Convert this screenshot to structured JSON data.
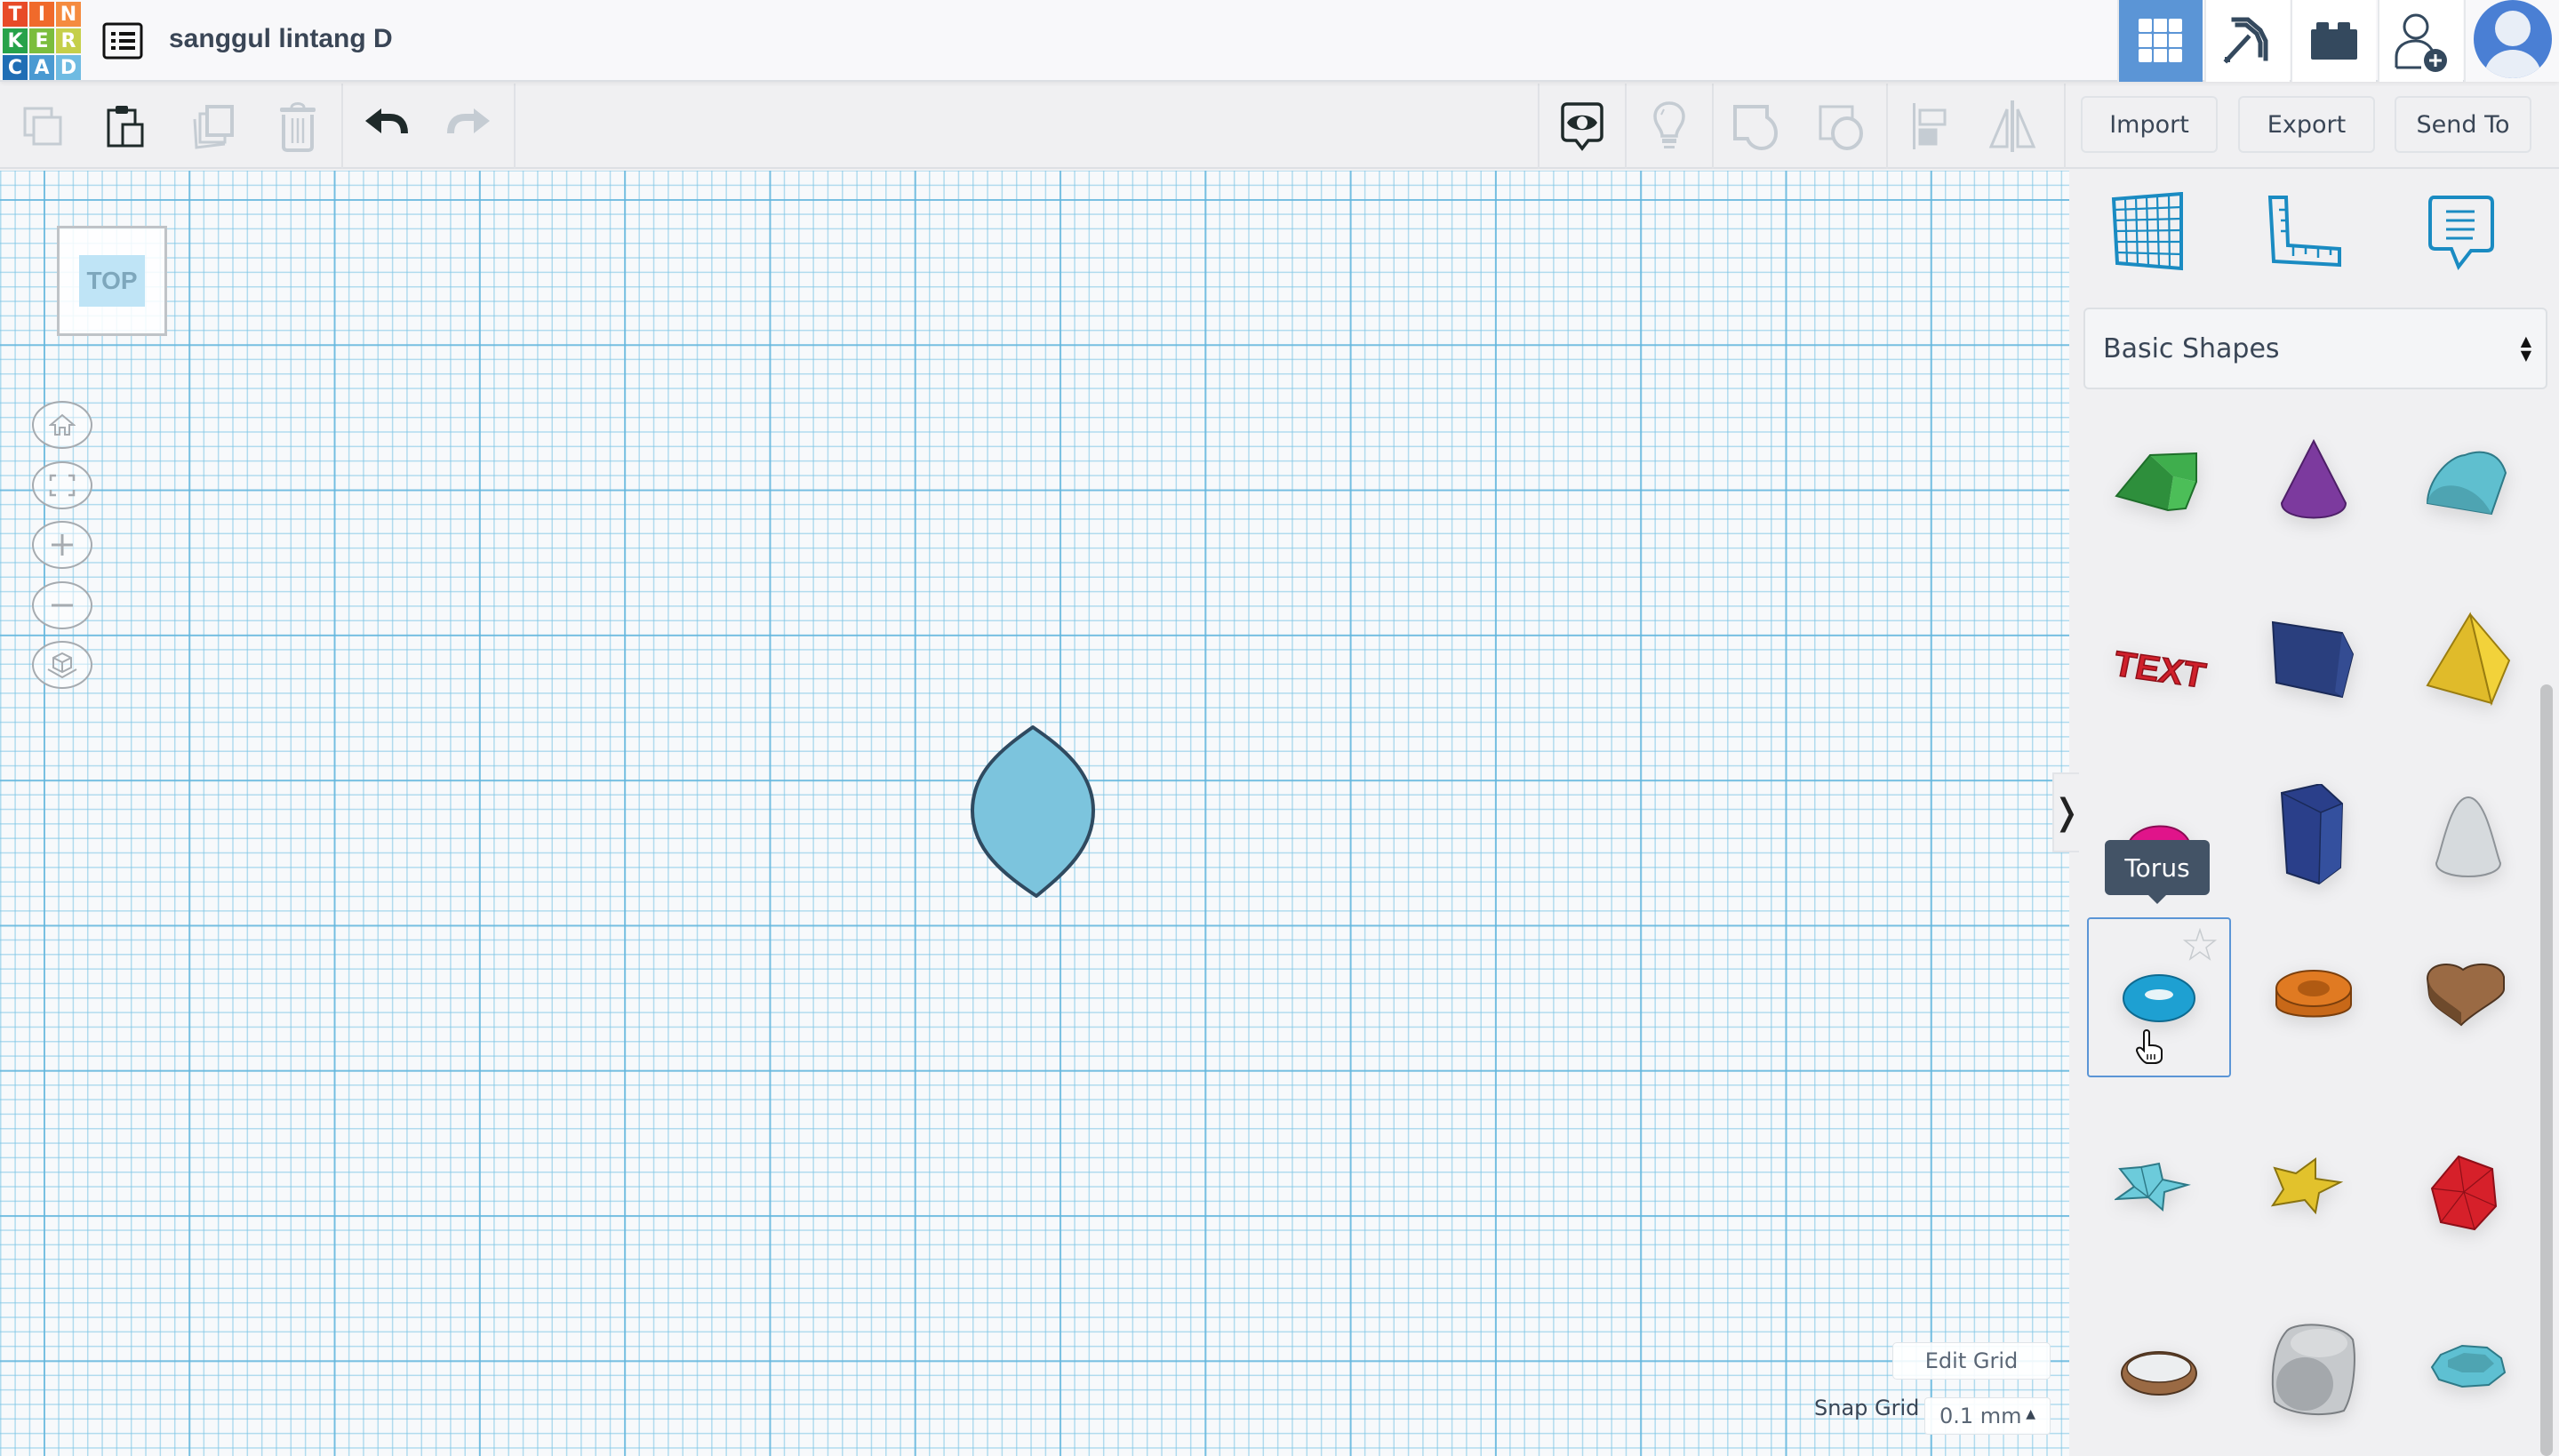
{
  "app": {
    "logo_letters": [
      "T",
      "I",
      "N",
      "K",
      "E",
      "R",
      "C",
      "A",
      "D"
    ],
    "logo_colors": [
      "#e84b28",
      "#f06a2b",
      "#f58b3f",
      "#27a24a",
      "#7bbd3d",
      "#c5cf4a",
      "#1f6eb5",
      "#4a9ad2",
      "#6fbbe2"
    ],
    "design_title": "sanggul lintang D"
  },
  "header": {
    "buttons": [
      {
        "name": "3d-design-view",
        "icon": "grid-icon",
        "active": true
      },
      {
        "name": "minecraft-view",
        "icon": "pickaxe-icon",
        "active": false
      },
      {
        "name": "lego-bricks-view",
        "icon": "brick-icon",
        "active": false
      },
      {
        "name": "invite-user",
        "icon": "user-add-icon",
        "active": false
      },
      {
        "name": "profile",
        "icon": "avatar-icon",
        "active": false
      }
    ],
    "accent_color": "#5b95d6"
  },
  "toolbar": {
    "copy": {
      "icon": "copy-icon",
      "enabled": false
    },
    "paste": {
      "icon": "paste-icon",
      "enabled": true
    },
    "duplicate": {
      "icon": "duplicate-icon",
      "enabled": false
    },
    "delete": {
      "icon": "trash-icon",
      "enabled": false
    },
    "undo": {
      "icon": "undo-icon",
      "enabled": true
    },
    "redo": {
      "icon": "redo-icon",
      "enabled": false
    },
    "notes": {
      "icon": "eye-speech-icon",
      "enabled": true
    },
    "hint": {
      "icon": "lightbulb-icon",
      "enabled": false
    },
    "group": {
      "icon": "group-icon",
      "enabled": false
    },
    "ungroup": {
      "icon": "ungroup-icon",
      "enabled": false
    },
    "align": {
      "icon": "align-icon",
      "enabled": false
    },
    "mirror": {
      "icon": "mirror-icon",
      "enabled": false
    },
    "import_label": "Import",
    "export_label": "Export",
    "send_to_label": "Send To"
  },
  "workplane": {
    "view_cube_label": "TOP",
    "nav_buttons": [
      "home-view",
      "fit-all",
      "zoom-in",
      "zoom-out",
      "perspective-toggle"
    ],
    "object": {
      "shape": "lens",
      "fill": "#7cc4dd",
      "stroke": "#2f4a60"
    },
    "edit_grid_label": "Edit Grid",
    "snap_grid_label": "Snap Grid",
    "snap_grid_value": "0.1 mm"
  },
  "panel": {
    "tools": [
      "workplane-tool",
      "ruler-tool",
      "notes-tool"
    ],
    "category": "Basic Shapes",
    "tooltip": "Torus",
    "toggle_glyph": "❭",
    "shapes": [
      {
        "name": "Roof",
        "color": "#3fae4d"
      },
      {
        "name": "Cone",
        "color": "#7c3a9e"
      },
      {
        "name": "Half Cylinder",
        "color": "#5fbfcf"
      },
      {
        "name": "Text",
        "color": "#d0202b"
      },
      {
        "name": "Polygon",
        "color": "#2a3f7e"
      },
      {
        "name": "Pyramid",
        "color": "#e8c52e"
      },
      {
        "name": "Half Sphere",
        "color": "#e0148a"
      },
      {
        "name": "Hexagonal Prism",
        "color": "#2a3f8a"
      },
      {
        "name": "Paraboloid",
        "color": "#d6dadd"
      },
      {
        "name": "Torus",
        "color": "#1ea0d2",
        "hovered": true
      },
      {
        "name": "Tube",
        "color": "#e07a22"
      },
      {
        "name": "Heart",
        "color": "#9a6a44"
      },
      {
        "name": "Star",
        "color": "#6ccbdb"
      },
      {
        "name": "Star Extruded",
        "color": "#e2c22c"
      },
      {
        "name": "Icosahedron",
        "color": "#d6202a"
      },
      {
        "name": "Ring",
        "color": "#9a6a44"
      },
      {
        "name": "Dice",
        "color": "#c6c9cc"
      },
      {
        "name": "Gem",
        "color": "#5ec0d2"
      }
    ]
  }
}
